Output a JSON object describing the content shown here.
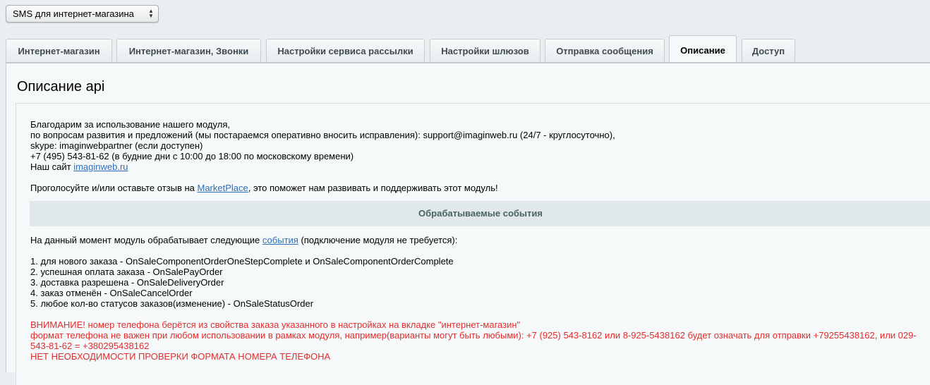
{
  "module_select": {
    "value": "SMS для интернет-магазина"
  },
  "tabs": [
    {
      "label": "Интернет-магазин",
      "active": false
    },
    {
      "label": "Интернет-магазин, Звонки",
      "active": false
    },
    {
      "label": "Настройки сервиса рассылки",
      "active": false
    },
    {
      "label": "Настройки шлюзов",
      "active": false
    },
    {
      "label": "Отправка сообщения",
      "active": false
    },
    {
      "label": "Описание",
      "active": true
    },
    {
      "label": "Доступ",
      "active": false
    }
  ],
  "panel": {
    "title": "Описание api",
    "intro": {
      "line1": "Благодарим за использование нашего модуля,",
      "line2": "по вопросам развития и предложений (мы постараемся оперативно вносить исправления): support@imaginweb.ru (24/7 - круглосуточно),",
      "line3": "skype: imaginwebpartner (если доступен)",
      "line4": "+7 (495) 543-81-62 (в будние дни с 10:00 до 18:00 по московскому времени)",
      "site_prefix": "Наш сайт ",
      "site_link": "imaginweb.ru"
    },
    "vote": {
      "prefix": "Проголосуйте и/или оставьте отзыв на ",
      "link": "MarketPlace",
      "suffix": ", это поможет нам развивать и поддерживать этот модуль!"
    },
    "events_header": "Обрабатываемые события",
    "events_intro": {
      "prefix": "На данный момент модуль обрабатывает следующие ",
      "link": "события",
      "suffix": " (подключение модуля не требуется):"
    },
    "events": [
      "1. для нового заказа - OnSaleComponentOrderOneStepComplete и OnSaleComponentOrderComplete",
      "2. успешная оплата заказа - OnSalePayOrder",
      "3. доставка разрешена - OnSaleDeliveryOrder",
      "4. заказ отменён - OnSaleCancelOrder",
      "5. любое кол-во статусов заказов(изменение) - OnSaleStatusOrder"
    ],
    "warning": {
      "line1": "ВНИМАНИЕ! номер телефона берётся из свойства заказа указанного в настройках на вкладке \"интернет-магазин\"",
      "line2": "формат телефона не важен при любом использовании в рамках модуля, например(варианты могут быть любыми): +7 (925) 543-8162 или 8-925-5438162 будет означать для отправки +79255438162, или 029-",
      "line3": "543-81-62 = +380295438162",
      "line4": "НЕТ НЕОБХОДИМОСТИ ПРОВЕРКИ ФОРМАТА НОМЕРА ТЕЛЕФОНА"
    }
  },
  "colors": {
    "link": "#2f6fb8",
    "warning": "#e22d2d",
    "header_bg": "#e0e8ea"
  }
}
